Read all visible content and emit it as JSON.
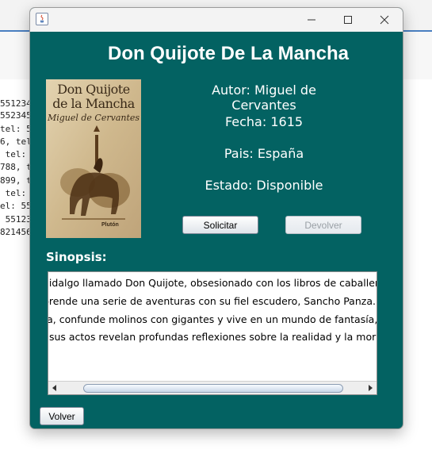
{
  "background_app": {
    "console_lines": [
      "551234",
      "552345",
      "tel: 55",
      "6, tel",
      " tel: ",
      "788, t",
      "899, t",
      " tel: ",
      "el: 55",
      " 55123",
      "821456"
    ]
  },
  "window": {
    "title": "",
    "controls": [
      "minimize-icon",
      "maximize-icon",
      "close-icon"
    ],
    "background_color": "#036262"
  },
  "book": {
    "title": "Don Quijote De La Mancha",
    "cover": {
      "title_line1": "Don Quijote",
      "title_line2": "de la Mancha",
      "author": "Miguel de Cervantes",
      "publisher": "Plutón"
    },
    "author_label": "Autor: Miguel de Cervantes",
    "date_label": "Fecha: 1615",
    "country_label": "Pais: España",
    "state_label": "Estado: Disponible"
  },
  "buttons": {
    "request": "Solicitar",
    "return": "Devolver",
    "back": "Volver"
  },
  "synopsis": {
    "label": "Sinopsis:",
    "lines": [
      "hidalgo llamado Don Quijote, obsesionado con los libros de caballería,",
      "prende una serie de aventuras con su fiel escudero, Sancho Panza. En",
      "ra, confunde molinos con gigantes y vive en un mundo de fantasía,",
      ", sus actos revelan profundas reflexiones sobre la realidad y la moral."
    ]
  }
}
